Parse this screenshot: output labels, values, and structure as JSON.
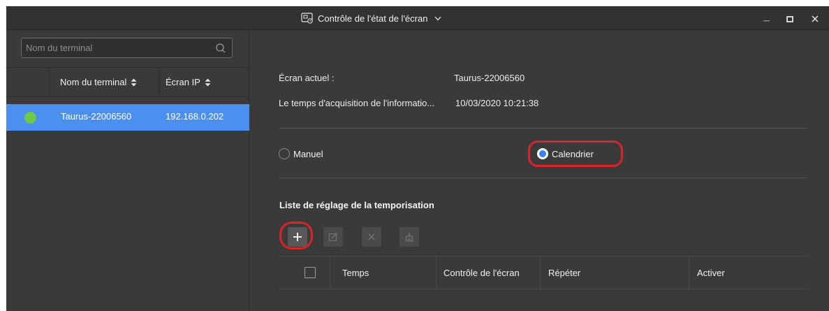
{
  "window": {
    "title": "Contrôle de l'état de l'écran",
    "controls": {
      "minimize": "minimize-icon",
      "maximize": "maximize-icon",
      "close": "close-icon"
    }
  },
  "left_panel": {
    "search": {
      "placeholder": "Nom du terminal",
      "value": ""
    },
    "columns": [
      {
        "label": "Nom du terminal"
      },
      {
        "label": "Écran IP"
      }
    ],
    "rows": [
      {
        "name": "Taurus-22006560",
        "ip": "192.168.0.202",
        "status_color": "#6ec84a",
        "selected": true
      }
    ]
  },
  "right_panel": {
    "current_screen_label": "Écran actuel :",
    "current_screen_value": "Taurus-22006560",
    "acquisition_label": "Le temps d'acquisition de l'informatio...",
    "acquisition_value": "10/03/2020 10:21:38",
    "modes": [
      {
        "label": "Manuel",
        "selected": false
      },
      {
        "label": "Calendrier",
        "selected": true
      }
    ],
    "schedule_title": "Liste de réglage de la temporisation",
    "toolbar": [
      "add-icon",
      "edit-icon",
      "delete-icon",
      "clear-icon"
    ],
    "table_columns": [
      {
        "label": "Temps"
      },
      {
        "label": "Contrôle de l'écran"
      },
      {
        "label": "Répéter"
      },
      {
        "label": "Activer"
      }
    ]
  },
  "colors": {
    "accent": "#4b8ff0",
    "highlight": "#d8232a",
    "status_online": "#6ec84a",
    "background": "#3a3a3a"
  }
}
